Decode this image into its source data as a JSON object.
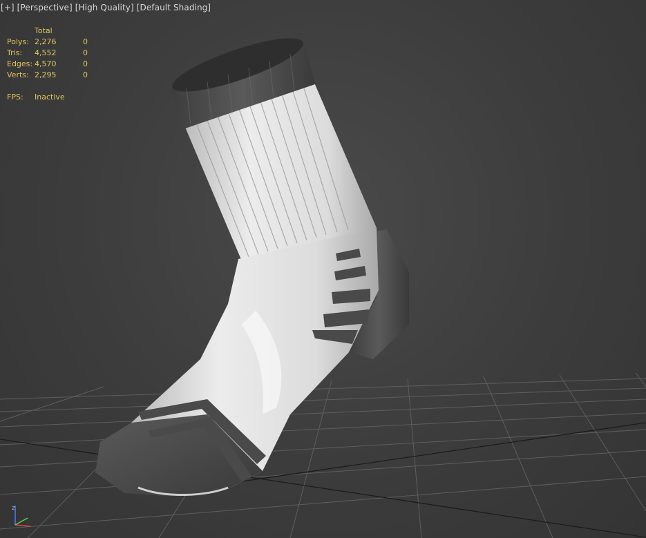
{
  "viewport": {
    "label_parts": [
      "[+]",
      "[Perspective]",
      "[High Quality]",
      "[Default Shading]"
    ]
  },
  "stats": {
    "header": "Total",
    "rows": [
      {
        "label": "Polys:",
        "total": "2,276",
        "selected": "0"
      },
      {
        "label": "Tris:",
        "total": "4,552",
        "selected": "0"
      },
      {
        "label": "Edges:",
        "total": "4,570",
        "selected": "0"
      },
      {
        "label": "Verts:",
        "total": "2,295",
        "selected": "0"
      }
    ],
    "fps_label": "FPS:",
    "fps_value": "Inactive"
  },
  "gizmo": {
    "z_label": "z",
    "icon": "axis-tripod-icon"
  },
  "colors": {
    "stats_text": "#e0c55c",
    "label_text": "#d7d7d7",
    "sock_white": "#e6e6e6",
    "sock_dark": "#4d4d4d",
    "grid": "#5c5c5c",
    "background": "#3c3c3c"
  }
}
